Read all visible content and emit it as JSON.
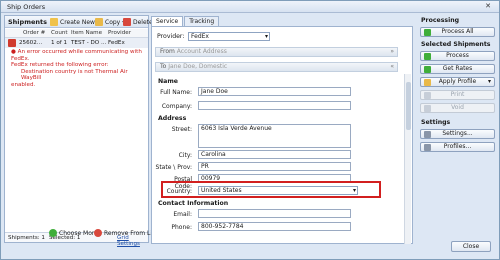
{
  "window": {
    "title": "Ship Orders",
    "close_glyph": "✕"
  },
  "shipments": {
    "heading": "Shipments",
    "create_new": "Create New",
    "copy": "Copy",
    "delete": "Delete",
    "columns": [
      "Order #",
      "Count",
      "Item Name",
      "Provider"
    ],
    "rows": [
      {
        "order": "25602...",
        "count": "1 of 1",
        "item": "TEST - DO ...",
        "provider": "FedEx"
      }
    ],
    "error_lines": [
      "● An error occurred while communicating with FedEx.",
      "FedEx returned the following error:",
      "Destination country is not Thermal Air WayBill",
      "enabled."
    ],
    "footer": {
      "shipments": "Shipments: 1",
      "selected": "Selected: 1",
      "grid_settings": "Grid Settings"
    },
    "choose_more": "Choose More",
    "remove_from_list": "Remove From List"
  },
  "tabs": [
    "Service",
    "Tracking"
  ],
  "service": {
    "provider_label": "Provider:",
    "provider_value": "FedEx",
    "from_label": "From",
    "from_value": "Account Address",
    "to_label": "To",
    "to_value": "Jane Doe, Domestic",
    "name_section": "Name",
    "full_name_label": "Full Name:",
    "full_name_value": "Jane Doe",
    "company_label": "Company:",
    "company_value": "",
    "address_section": "Address",
    "street_label": "Street:",
    "street_value": "6063 Isla Verde Avenue",
    "city_label": "City:",
    "city_value": "Carolina",
    "state_label": "State \\ Prov:",
    "state_value": "PR",
    "postal_label": "Postal Code:",
    "postal_value": "00979",
    "country_label": "Country:",
    "country_value": "United States",
    "contact_section": "Contact Information",
    "email_label": "Email:",
    "email_value": "",
    "phone_label": "Phone:",
    "phone_value": "800-952-7784"
  },
  "right": {
    "processing": "Processing",
    "process_all": "Process All",
    "selected_shipments": "Selected Shipments",
    "process": "Process",
    "get_rates": "Get Rates",
    "apply_profile": "Apply Profile",
    "print": "Print",
    "void": "Void",
    "settings_head": "Settings",
    "settings": "Settings...",
    "profiles": "Profiles..."
  },
  "close_button": "Close",
  "colors": {
    "accent": "#1f4fa8",
    "error": "#cc1f1f",
    "highlight": "#d21f1f"
  }
}
